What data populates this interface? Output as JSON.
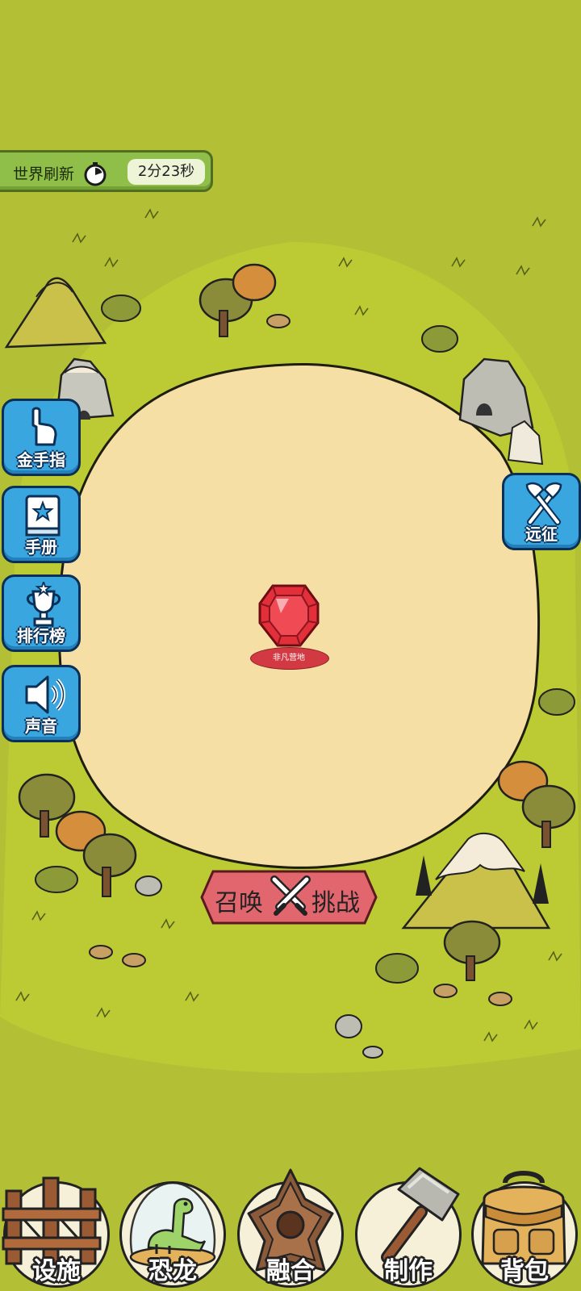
{
  "top_bar": {
    "label": "世界刷新",
    "timer": "2分23秒",
    "icon": "stopwatch-icon"
  },
  "side_menu": {
    "items": [
      {
        "label": "金手指",
        "icon": "pointing-hand-icon"
      },
      {
        "label": "手册",
        "icon": "book-icon"
      },
      {
        "label": "排行榜",
        "icon": "trophy-icon"
      },
      {
        "label": "声音",
        "icon": "speaker-icon"
      }
    ]
  },
  "expedition": {
    "label": "远征",
    "icon": "crossed-axes-icon"
  },
  "base": {
    "label": "非凡营地",
    "icon": "red-gem-icon"
  },
  "summon": {
    "left_label": "召唤",
    "right_label": "挑战",
    "icon": "crossed-swords-icon"
  },
  "bottom_nav": [
    {
      "label": "设施",
      "icon": "fence-icon"
    },
    {
      "label": "恐龙",
      "icon": "dinosaur-icon"
    },
    {
      "label": "融合",
      "icon": "fusion-icon"
    },
    {
      "label": "制作",
      "icon": "hammer-icon"
    },
    {
      "label": "背包",
      "icon": "backpack-icon"
    }
  ],
  "colors": {
    "grass": "#b3bf34",
    "clearing": "#f6dfa4",
    "button_blue": "#3aa6e0",
    "summon_red": "#e2666e"
  }
}
